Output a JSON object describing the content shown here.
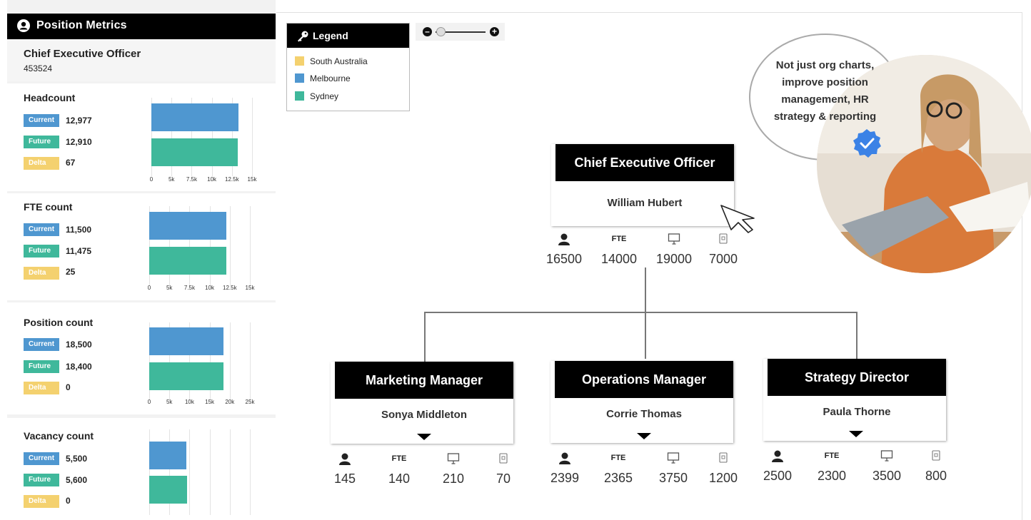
{
  "left_panel": {
    "header_title": "Position Metrics",
    "selected_position": {
      "title": "Chief Executive Officer",
      "code": "453524"
    },
    "tag_labels": {
      "current": "Current",
      "future": "Future",
      "delta": "Delta"
    },
    "metrics": [
      {
        "title": "Headcount",
        "current": "12,977",
        "future": "12,910",
        "delta": "67",
        "chart": {
          "type": "bar",
          "categories": [
            "Current",
            "Future"
          ],
          "values": [
            12977,
            12910
          ],
          "ticks": [
            "0",
            "5k",
            "7.5k",
            "10k",
            "12.5k",
            "15k"
          ],
          "xlim": [
            0,
            15000
          ]
        }
      },
      {
        "title": "FTE count",
        "current": "11,500",
        "future": "11,475",
        "delta": "25",
        "chart": {
          "type": "bar",
          "categories": [
            "Current",
            "Future"
          ],
          "values": [
            11500,
            11475
          ],
          "ticks": [
            "0",
            "5k",
            "7.5k",
            "10k",
            "12.5k",
            "15k"
          ],
          "xlim": [
            0,
            15000
          ]
        }
      },
      {
        "title": "Position count",
        "current": "18,500",
        "future": "18,400",
        "delta": "0",
        "chart": {
          "type": "bar",
          "categories": [
            "Current",
            "Future"
          ],
          "values": [
            18500,
            18400
          ],
          "ticks": [
            "0",
            "5k",
            "10k",
            "15k",
            "20k",
            "25k"
          ],
          "xlim": [
            0,
            25000
          ]
        }
      },
      {
        "title": "Vacancy count",
        "current": "5,500",
        "future": "5,600",
        "delta": "0",
        "chart": {
          "type": "bar",
          "categories": [
            "Current",
            "Future"
          ],
          "values": [
            5500,
            5600
          ],
          "ticks": [],
          "xlim": [
            0,
            15000
          ]
        }
      }
    ]
  },
  "legend": {
    "title": "Legend",
    "items": [
      {
        "label": "South Australia",
        "color": "#f4d16f"
      },
      {
        "label": "Melbourne",
        "color": "#4f97d0"
      },
      {
        "label": "Sydney",
        "color": "#3fb89b"
      }
    ]
  },
  "zoom": {
    "minus_icon": "minus-icon",
    "plus_icon": "plus-icon",
    "level": 0.1
  },
  "stat_labels": {
    "fte": "FTE"
  },
  "colors": {
    "sa": "#f4d16f",
    "melbourne": "#4f97d0",
    "sydney": "#3fb89b"
  },
  "org": {
    "ceo": {
      "title": "Chief Executive Officer",
      "name": "William Hubert",
      "stats": [
        "16500",
        "14000",
        "19000",
        "7000"
      ]
    },
    "marketing": {
      "title": "Marketing Manager",
      "name": "Sonya Middleton",
      "stats": [
        "145",
        "140",
        "210",
        "70"
      ]
    },
    "operations": {
      "title": "Operations Manager",
      "name": "Corrie Thomas",
      "stats": [
        "2399",
        "2365",
        "3750",
        "1200"
      ]
    },
    "strategy": {
      "title": "Strategy Director",
      "name": "Paula Thorne",
      "stats": [
        "2500",
        "2300",
        "3500",
        "800"
      ]
    }
  },
  "promo": {
    "text": "Not just org charts, improve position management, HR strategy & reporting"
  }
}
